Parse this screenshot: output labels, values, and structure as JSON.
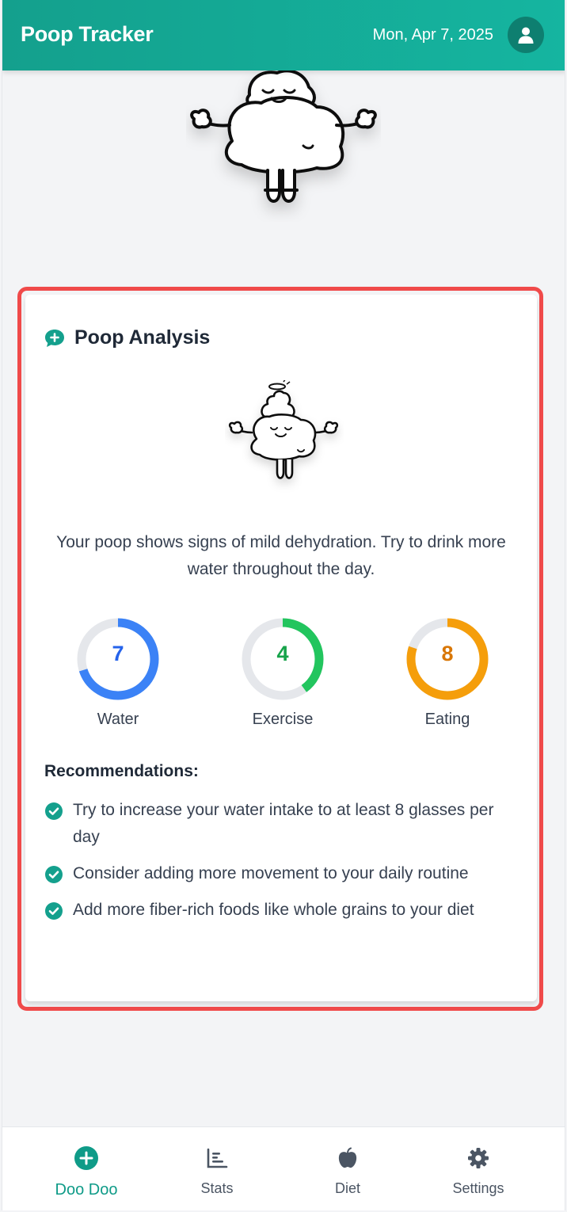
{
  "header": {
    "title": "Poop Tracker",
    "date": "Mon, Apr 7, 2025",
    "avatar_icon": "user-icon",
    "color": "#14a08d"
  },
  "analysis": {
    "title": "Poop Analysis",
    "title_icon": "chat-plus-icon",
    "summary": "Your poop shows signs of mild dehydration. Try to drink more water throughout the day.",
    "scores": [
      {
        "label": "Water",
        "value": "7",
        "max": 10,
        "color": "#3b82f6",
        "text_color": "#2563eb"
      },
      {
        "label": "Exercise",
        "value": "4",
        "max": 10,
        "color": "#22c55e",
        "text_color": "#16a34a"
      },
      {
        "label": "Eating",
        "value": "8",
        "max": 10,
        "color": "#f59e0b",
        "text_color": "#d97706"
      }
    ],
    "recommendations_title": "Recommendations:",
    "recommendations": [
      "Try to increase your water intake to at least 8 glasses per day",
      "Consider adding more movement to your daily routine",
      "Add more fiber-rich foods like whole grains to your diet"
    ],
    "accent_color": "#14a08d",
    "highlight_border_color": "#f04a4a"
  },
  "nav": {
    "items": [
      {
        "label": "Doo Doo",
        "icon": "plus-circle-icon",
        "active": true
      },
      {
        "label": "Stats",
        "icon": "chart-bars-icon",
        "active": false
      },
      {
        "label": "Diet",
        "icon": "apple-icon",
        "active": false
      },
      {
        "label": "Settings",
        "icon": "gear-icon",
        "active": false
      }
    ]
  }
}
